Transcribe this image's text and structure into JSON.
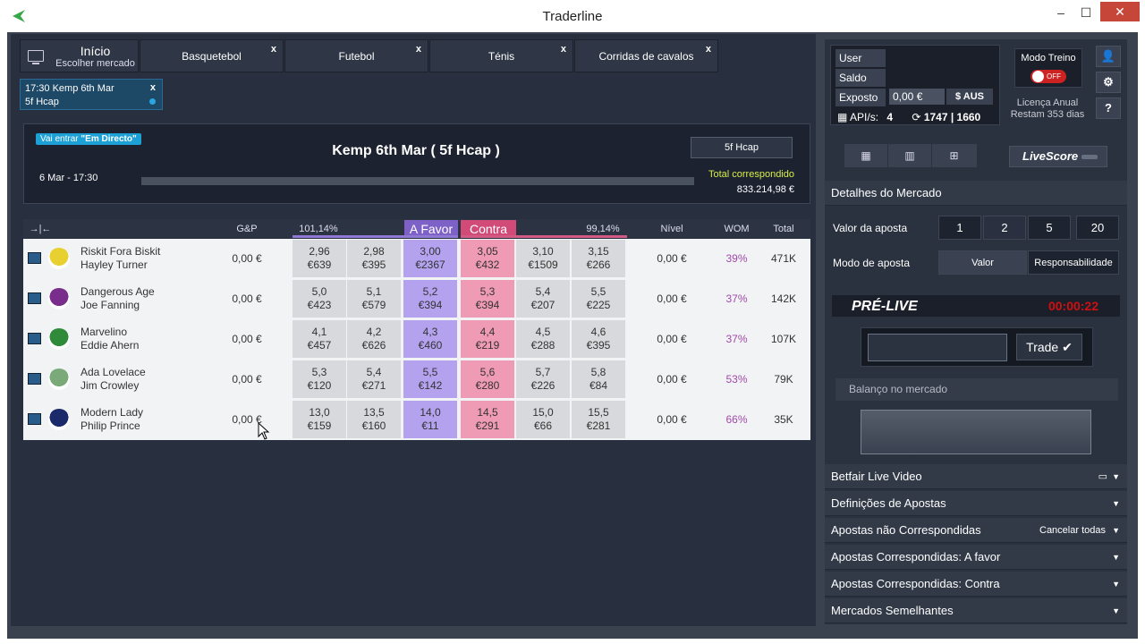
{
  "window": {
    "title": "Traderline",
    "minimize": "–",
    "maximize": "☐",
    "close": "✕"
  },
  "tabs": {
    "home": {
      "label": "Início",
      "sublabel": "Escolher mercado"
    },
    "items": [
      {
        "label": "Basquetebol",
        "close": "x"
      },
      {
        "label": "Futebol",
        "close": "x"
      },
      {
        "label": "Ténis",
        "close": "x"
      },
      {
        "label": "Corridas de cavalos",
        "close": "x"
      }
    ]
  },
  "market_chip": {
    "line1": "17:30 Kemp 6th Mar",
    "line2": "5f Hcap",
    "close": "x"
  },
  "market": {
    "badge_prefix": "Vai entrar",
    "badge_status": "\"Em Directo\"",
    "title": "Kemp 6th Mar ( 5f Hcap )",
    "date": "6 Mar - 17:30",
    "market_button": "5f Hcap",
    "total_label": "Total correspondido",
    "total_value": "833.214,98 €"
  },
  "grid": {
    "toggle_icon": "→|←",
    "headers": {
      "gp": "G&P",
      "back_pct": "101,14%",
      "back": "A Favor",
      "lay": "Contra",
      "lay_pct": "99,14%",
      "level": "Nível",
      "wom": "WOM",
      "total": "Total"
    },
    "runners": [
      {
        "name": "Riskit Fora Biskit",
        "jockey": "Hayley Turner",
        "gp": "0,00 €",
        "silk_color": "#e8d030",
        "prices": [
          {
            "o": "2,96",
            "v": "€639"
          },
          {
            "o": "2,98",
            "v": "€395"
          },
          {
            "o": "3,00",
            "v": "€2367"
          },
          {
            "o": "3,05",
            "v": "€432"
          },
          {
            "o": "3,10",
            "v": "€1509"
          },
          {
            "o": "3,15",
            "v": "€266"
          }
        ],
        "level": "0,00 €",
        "wom": "39%",
        "total": "471K"
      },
      {
        "name": "Dangerous Age",
        "jockey": "Joe Fanning",
        "gp": "0,00 €",
        "silk_color": "#7a2e8c",
        "prices": [
          {
            "o": "5,0",
            "v": "€423"
          },
          {
            "o": "5,1",
            "v": "€579"
          },
          {
            "o": "5,2",
            "v": "€394"
          },
          {
            "o": "5,3",
            "v": "€394"
          },
          {
            "o": "5,4",
            "v": "€207"
          },
          {
            "o": "5,5",
            "v": "€225"
          }
        ],
        "level": "0,00 €",
        "wom": "37%",
        "total": "142K"
      },
      {
        "name": "Marvelino",
        "jockey": "Eddie Ahern",
        "gp": "0,00 €",
        "silk_color": "#2f8a3a",
        "prices": [
          {
            "o": "4,1",
            "v": "€457"
          },
          {
            "o": "4,2",
            "v": "€626"
          },
          {
            "o": "4,3",
            "v": "€460"
          },
          {
            "o": "4,4",
            "v": "€219"
          },
          {
            "o": "4,5",
            "v": "€288"
          },
          {
            "o": "4,6",
            "v": "€395"
          }
        ],
        "level": "0,00 €",
        "wom": "37%",
        "total": "107K"
      },
      {
        "name": "Ada Lovelace",
        "jockey": "Jim Crowley",
        "gp": "0,00 €",
        "silk_color": "#7aaa7a",
        "prices": [
          {
            "o": "5,3",
            "v": "€120"
          },
          {
            "o": "5,4",
            "v": "€271"
          },
          {
            "o": "5,5",
            "v": "€142"
          },
          {
            "o": "5,6",
            "v": "€280"
          },
          {
            "o": "5,7",
            "v": "€226"
          },
          {
            "o": "5,8",
            "v": "€84"
          }
        ],
        "level": "0,00 €",
        "wom": "53%",
        "total": "79K"
      },
      {
        "name": "Modern Lady",
        "jockey": "Philip Prince",
        "gp": "0,00 €",
        "silk_color": "#1a2a6a",
        "prices": [
          {
            "o": "13,0",
            "v": "€159"
          },
          {
            "o": "13,5",
            "v": "€160"
          },
          {
            "o": "14,0",
            "v": "€11"
          },
          {
            "o": "14,5",
            "v": "€291"
          },
          {
            "o": "15,0",
            "v": "€66"
          },
          {
            "o": "15,5",
            "v": "€281"
          }
        ],
        "level": "0,00 €",
        "wom": "66%",
        "total": "35K"
      }
    ]
  },
  "account": {
    "user_label": "User",
    "saldo_label": "Saldo",
    "exposto_label": "Exposto",
    "exposto_value": "0,00 €",
    "currency_button": "$ AUS",
    "api_label": "API/s:",
    "api_value": "4",
    "api_counter": "1747 | 1660",
    "treino_label": "Modo Treino",
    "toggle_label": "OFF",
    "license_line1": "Licença Anual",
    "license_line2": "Restam 353 dias"
  },
  "right": {
    "livescore": "LiveScore",
    "detalhes": "Detalhes do Mercado",
    "valor_label": "Valor da aposta",
    "stakes": [
      "1",
      "2",
      "5",
      "20"
    ],
    "modo_label": "Modo de aposta",
    "modes": [
      "Valor",
      "Responsabilidade"
    ],
    "prelive": "PRÉ-LIVE",
    "timer": "00:00:22",
    "trade_button": "Trade",
    "balanco": "Balanço no mercado",
    "sections": [
      "Betfair Live Video",
      "Definições de Apostas",
      "Apostas não Correspondidas",
      "Apostas Correspondidas: A favor",
      "Apostas Correspondidas: Contra",
      "Mercados Semelhantes"
    ],
    "cancel_all": "Cancelar todas"
  }
}
